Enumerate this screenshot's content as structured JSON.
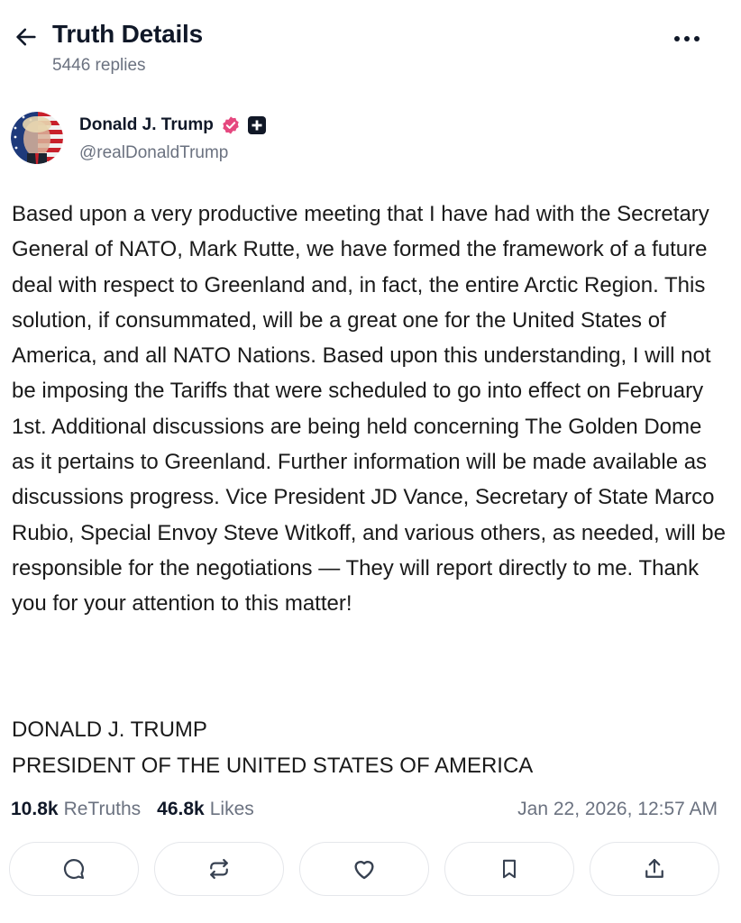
{
  "header": {
    "title": "Truth Details",
    "subtitle": "5446 replies"
  },
  "author": {
    "name": "Donald J. Trump",
    "handle": "@realDonaldTrump",
    "verified_color": "#e5487f"
  },
  "post": {
    "body": "Based upon a very productive meeting that I have had with the Secretary General of NATO, Mark Rutte, we have formed the framework of a future deal with respect to Greenland and, in fact, the entire Arctic Region. This solution, if consummated, will be a great one for the United States of America, and all NATO Nations. Based upon this understanding, I will not be imposing the Tariffs that were scheduled to go into effect on February 1st. Additional discussions are being held concerning The Golden Dome as it pertains to Greenland. Further information will be made available as discussions progress. Vice President JD Vance, Secretary of State Marco Rubio, Special Envoy Steve Witkoff, and various others, as needed, will be responsible for the negotiations — They will report directly to me. Thank you for your attention to this matter!",
    "signature_line1": "DONALD J. TRUMP",
    "signature_line2": "PRESIDENT OF THE UNITED STATES OF AMERICA"
  },
  "stats": {
    "retruths_count": "10.8k",
    "retruths_label": "ReTruths",
    "likes_count": "46.8k",
    "likes_label": "Likes",
    "timestamp": "Jan 22, 2026, 12:57 AM"
  },
  "actions": [
    {
      "icon": "reply-icon"
    },
    {
      "icon": "retruth-icon"
    },
    {
      "icon": "heart-icon"
    },
    {
      "icon": "bookmark-icon"
    },
    {
      "icon": "share-icon"
    }
  ]
}
